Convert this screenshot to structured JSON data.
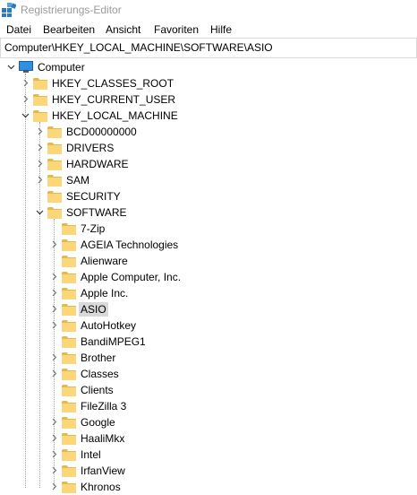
{
  "window": {
    "title": "Registrierungs-Editor"
  },
  "menu": [
    "Datei",
    "Bearbeiten",
    "Ansicht",
    "Favoriten",
    "Hilfe"
  ],
  "address": "Computer\\HKEY_LOCAL_MACHINE\\SOFTWARE\\ASIO",
  "tree": {
    "root": "Computer",
    "hives": [
      "HKEY_CLASSES_ROOT",
      "HKEY_CURRENT_USER",
      "HKEY_LOCAL_MACHINE"
    ],
    "hklm_children": [
      "BCD00000000",
      "DRIVERS",
      "HARDWARE",
      "SAM",
      "SECURITY",
      "SOFTWARE"
    ],
    "software_children": [
      "7-Zip",
      "AGEIA Technologies",
      "Alienware",
      "Apple Computer, Inc.",
      "Apple Inc.",
      "ASIO",
      "AutoHotkey",
      "BandiMPEG1",
      "Brother",
      "Classes",
      "Clients",
      "FileZilla 3",
      "Google",
      "HaaliMkx",
      "Intel",
      "IrfanView",
      "Khronos"
    ],
    "selected": "ASIO"
  }
}
